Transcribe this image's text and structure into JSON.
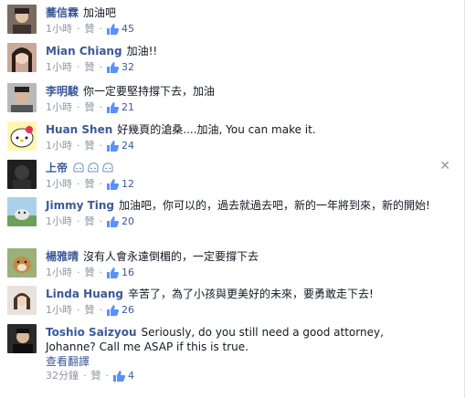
{
  "comments": [
    {
      "author": "蕎信霖",
      "text": "加油吧",
      "time": "1小時",
      "like_label": "贊",
      "likes": "45"
    },
    {
      "author": "Mian Chiang",
      "text": "加油!!",
      "time": "1小時",
      "like_label": "贊",
      "likes": "32"
    },
    {
      "author": "李明駿",
      "text": "你一定要堅持撐下去，加油",
      "time": "1小時",
      "like_label": "贊",
      "likes": "21"
    },
    {
      "author": "Huan Shen",
      "text": "好幾頁的滄桑....加油, You can make it.",
      "time": "1小時",
      "like_label": "贊",
      "likes": "24"
    },
    {
      "author": "上帝",
      "text": "",
      "time": "1小時",
      "like_label": "贊",
      "likes": "12"
    },
    {
      "author": "Jimmy Ting",
      "text": "加油吧，你可以的，過去就過去吧，新的一年將到來，新的開始!",
      "time": "1小時",
      "like_label": "贊",
      "likes": "20"
    },
    {
      "author": "楊雅晴",
      "text": "沒有人會永遠倒楣的，一定要撐下去",
      "time": "1小時",
      "like_label": "贊",
      "likes": "16"
    },
    {
      "author": "Linda Huang",
      "text": "辛苦了，為了小孩與更美好的未來，要勇敢走下去!",
      "time": "1小時",
      "like_label": "贊",
      "likes": "26"
    },
    {
      "author": "Toshio Saizyou",
      "text": "Seriously, do you still need a good attorney, Johanne? Call me ASAP if this is true.",
      "translate": "查看翻譯",
      "time": "32分鐘",
      "like_label": "贊",
      "likes": "4"
    }
  ],
  "close_symbol": "✕",
  "separator": "·",
  "colors": {
    "link": "#3b5998",
    "meta": "#9197a3",
    "text": "#141823"
  },
  "icons": {
    "like": "thumbs-up-icon",
    "close": "close-icon",
    "emoticon": "emoticon-icon"
  }
}
